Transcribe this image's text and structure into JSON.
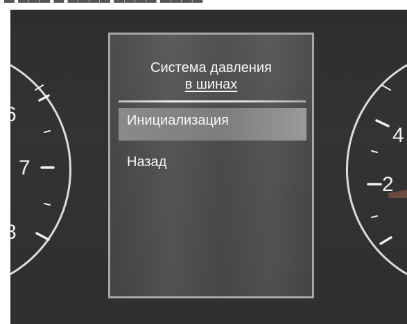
{
  "display": {
    "title_line1": "Система давления",
    "title_line2": "в шинах",
    "menu": [
      {
        "label": "Инициализация",
        "selected": true
      },
      {
        "label": "Назад",
        "selected": false
      }
    ]
  },
  "left_gauge": {
    "labels": [
      "6",
      "7",
      "8"
    ]
  },
  "right_gauge": {
    "labels": [
      "4",
      "2"
    ]
  }
}
